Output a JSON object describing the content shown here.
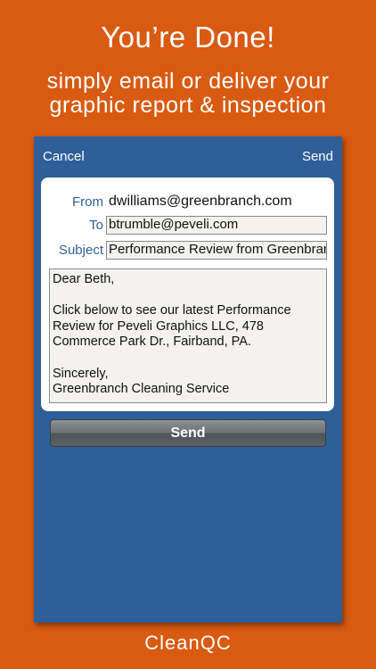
{
  "banner": {
    "headline": "You’re Done!",
    "subline_1": "simply email or deliver your",
    "subline_2": "graphic report & inspection"
  },
  "navbar": {
    "cancel_label": "Cancel",
    "send_label": "Send"
  },
  "email": {
    "from_label": "From",
    "from_value": "dwilliams@greenbranch.com",
    "to_label": "To",
    "to_value": "btrumble@peveli.com",
    "subject_label": "Subject",
    "subject_value": "Performance Review from Greenbranch",
    "body_lines": [
      "Dear Beth,",
      "",
      "Click below to see our latest Performance",
      "Review for Peveli Graphics LLC, 478",
      "Commerce Park Dr., Fairband, PA.",
      "",
      "Sincerely,",
      "Greenbranch Cleaning Service"
    ]
  },
  "send_button_label": "Send",
  "brand": "CleanQC",
  "colors": {
    "background": "#d95a11",
    "panel": "#2e5f98",
    "label": "#2e5f98"
  }
}
